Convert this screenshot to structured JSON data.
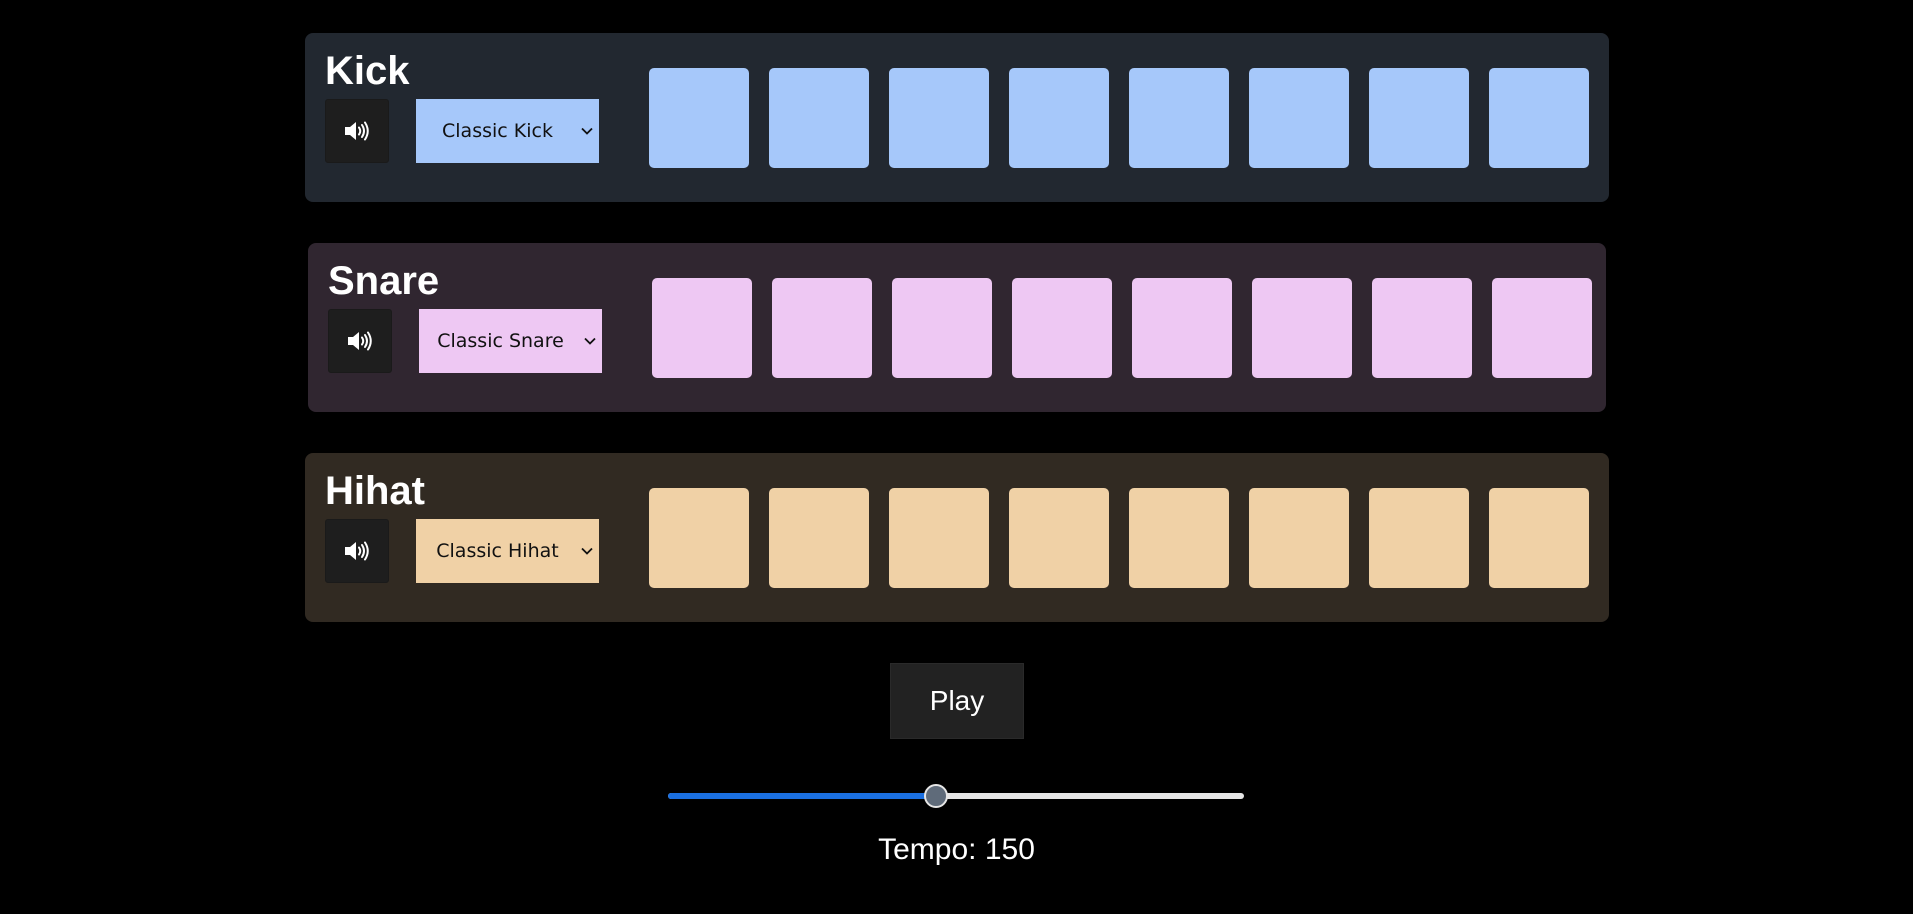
{
  "tracks": [
    {
      "name": "Kick",
      "sample": "Classic Kick",
      "panel_color": "#222830",
      "select_color": "#a6c8fa",
      "pad_color": "#a6c8fa",
      "mute_icon": "speaker-icon",
      "steps": [
        false,
        false,
        false,
        false,
        false,
        false,
        false,
        false
      ]
    },
    {
      "name": "Snare",
      "sample": "Classic Snare",
      "panel_color": "#302630",
      "select_color": "#eec8f3",
      "pad_color": "#eec8f3",
      "mute_icon": "speaker-icon",
      "steps": [
        false,
        false,
        false,
        false,
        false,
        false,
        false,
        false
      ]
    },
    {
      "name": "Hihat",
      "sample": "Classic Hihat",
      "panel_color": "#312a22",
      "select_color": "#f0d1a6",
      "pad_color": "#f0d1a6",
      "mute_icon": "speaker-icon",
      "steps": [
        false,
        false,
        false,
        false,
        false,
        false,
        false,
        false
      ]
    }
  ],
  "transport": {
    "play_label": "Play",
    "tempo_value": 150,
    "tempo_fraction": 0.466,
    "tempo_label": "Tempo: 150",
    "slider_fill_color": "#1a6fe0"
  }
}
